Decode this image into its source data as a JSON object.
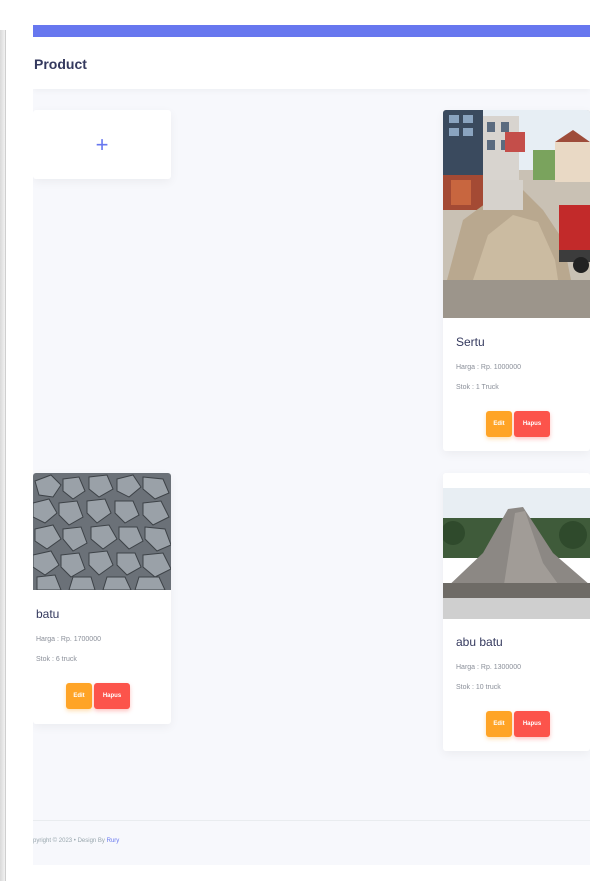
{
  "colors": {
    "accent": "#6777ef",
    "edit": "#ffa426",
    "delete": "#fc544b"
  },
  "header": {
    "title": "Product"
  },
  "add_card": {
    "icon": "plus-icon",
    "symbol": "+"
  },
  "products": [
    {
      "name": "Sertu",
      "price": "Harga : Rp. 1000000",
      "stock": "Stok : 1 Truck",
      "edit_label": "Edit",
      "delete_label": "Hapus",
      "image": "sand-pile-street-photo"
    },
    {
      "name": "batu",
      "price": "Harga : Rp. 1700000",
      "stock": "Stok : 6 truck",
      "edit_label": "Edit",
      "delete_label": "Hapus",
      "image": "gravel-stones-photo"
    },
    {
      "name": "abu batu",
      "price": "Harga : Rp. 1300000",
      "stock": "Stok : 10 truck",
      "edit_label": "Edit",
      "delete_label": "Hapus",
      "image": "stone-dust-pile-photo"
    }
  ],
  "footer": {
    "copyright": "pyright © 2023",
    "separator": "•",
    "design_by": "Design By",
    "author": "Rury"
  }
}
